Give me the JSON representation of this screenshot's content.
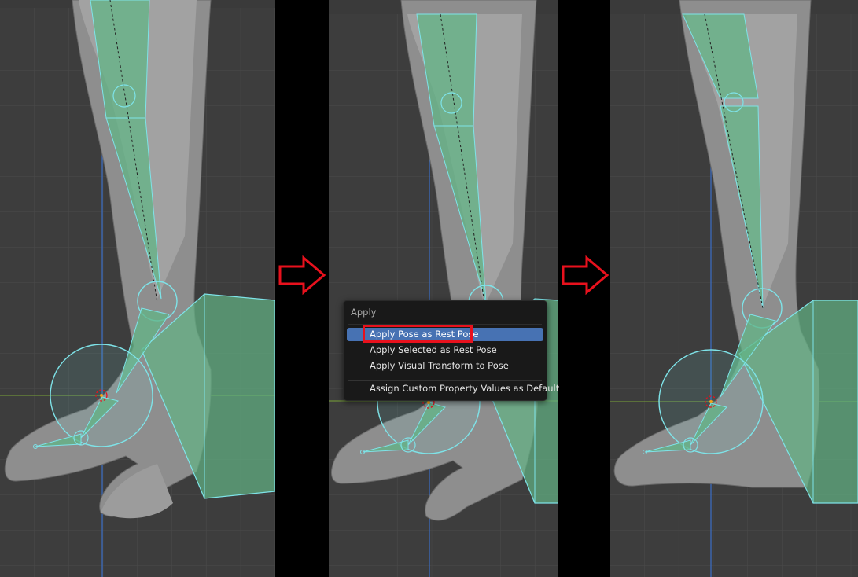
{
  "viewports": [
    {
      "name": "before",
      "description_icon": "armature-viewport-icon"
    },
    {
      "name": "apply-menu",
      "description_icon": "armature-viewport-icon"
    },
    {
      "name": "after",
      "description_icon": "armature-viewport-icon"
    }
  ],
  "arrows": [
    {
      "icon": "right-arrow-icon",
      "color": "#e8111d"
    },
    {
      "icon": "right-arrow-icon",
      "color": "#e8111d"
    }
  ],
  "apply_menu": {
    "title": "Apply",
    "items": [
      {
        "label": "Apply Pose as Rest Pose",
        "active": true,
        "highlighted": true
      },
      {
        "label": "Apply Selected as Rest Pose",
        "active": false
      },
      {
        "label": "Apply Visual Transform to Pose",
        "active": false
      },
      {
        "label": "Assign Custom Property Values as Default",
        "active": false
      }
    ]
  },
  "colors": {
    "viewport_bg": "#3d3d3d",
    "bone_fill": "#62b485",
    "bone_outline": "#7ee3e8",
    "menu_active": "#4772b3",
    "highlight": "#e8111d"
  }
}
